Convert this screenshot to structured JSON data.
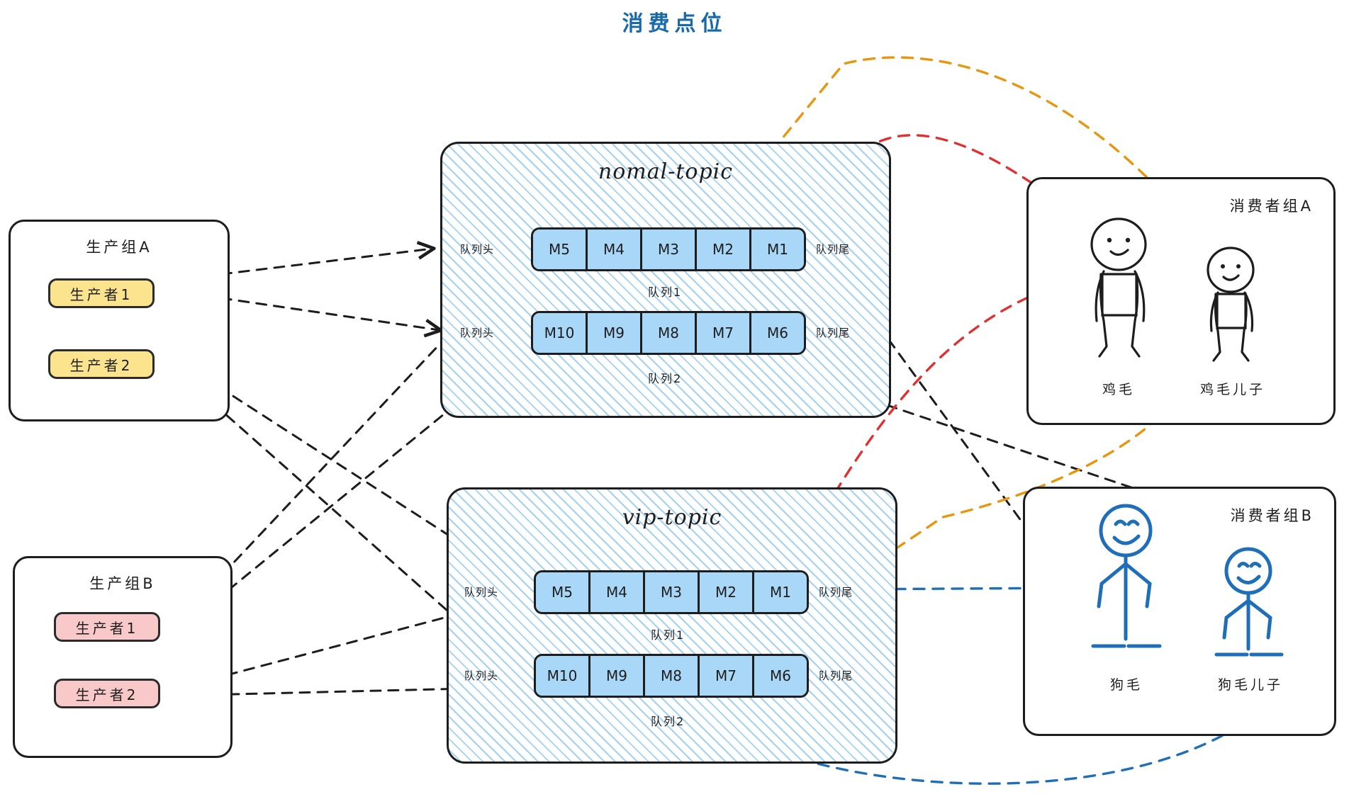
{
  "page": {
    "title": "消费点位",
    "title_color": "#1769aa"
  },
  "colors": {
    "producer_a_fill": "#fbe48d",
    "producer_b_fill": "#f9c8c8",
    "message_fill": "#a9d7f7",
    "topic_hatch": "#82c3f0",
    "ink": "#1d1d1d",
    "consumer_b_ink": "#1f6fb8",
    "flow_red": "#e03030",
    "flow_orange": "#e8960f",
    "flow_blue": "#1f6fb8",
    "flow_black": "#1d1d1d"
  },
  "producer_groups": [
    {
      "id": "producer-group-a",
      "label": "生产组A",
      "producers": [
        {
          "id": "producer-a-1",
          "label": "生产者1"
        },
        {
          "id": "producer-a-2",
          "label": "生产者2"
        }
      ]
    },
    {
      "id": "producer-group-b",
      "label": "生产组B",
      "producers": [
        {
          "id": "producer-b-1",
          "label": "生产者1"
        },
        {
          "id": "producer-b-2",
          "label": "生产者2"
        }
      ]
    }
  ],
  "topics": [
    {
      "id": "nomal-topic",
      "title": "nomal-topic",
      "queues": [
        {
          "name": "队列1",
          "head_label": "队列头",
          "tail_label": "队列尾",
          "messages": [
            "M5",
            "M4",
            "M3",
            "M2",
            "M1"
          ]
        },
        {
          "name": "队列2",
          "head_label": "队列头",
          "tail_label": "队列尾",
          "messages": [
            "M10",
            "M9",
            "M8",
            "M7",
            "M6"
          ]
        }
      ]
    },
    {
      "id": "vip-topic",
      "title": "vip-topic",
      "queues": [
        {
          "name": "队列1",
          "head_label": "队列头",
          "tail_label": "队列尾",
          "messages": [
            "M5",
            "M4",
            "M3",
            "M2",
            "M1"
          ]
        },
        {
          "name": "队列2",
          "head_label": "队列头",
          "tail_label": "队列尾",
          "messages": [
            "M10",
            "M9",
            "M8",
            "M7",
            "M6"
          ]
        }
      ]
    }
  ],
  "consumer_groups": [
    {
      "id": "consumer-group-a",
      "label": "消费者组A",
      "style": "black",
      "consumers": [
        {
          "id": "consumer-a-1",
          "label": "鸡毛"
        },
        {
          "id": "consumer-a-2",
          "label": "鸡毛儿子"
        }
      ]
    },
    {
      "id": "consumer-group-b",
      "label": "消费者组B",
      "style": "blue",
      "consumers": [
        {
          "id": "consumer-b-1",
          "label": "狗毛"
        },
        {
          "id": "consumer-b-2",
          "label": "狗毛儿子"
        }
      ]
    }
  ]
}
